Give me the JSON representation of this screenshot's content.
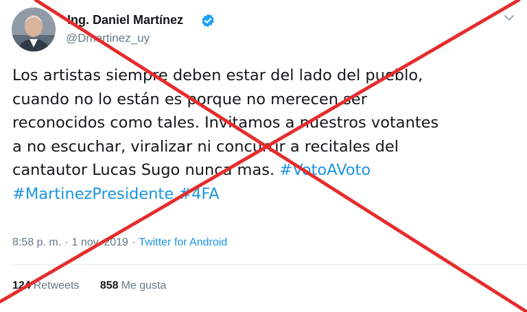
{
  "author": {
    "display_name": "Ing. Daniel Martínez",
    "handle": "@Dmartinez_uy",
    "verified": true,
    "avatar_icon": "profile-photo"
  },
  "tweet": {
    "lines": [
      {
        "text": "Los artistas siempre deben estar del lado del pueblo,",
        "tags": []
      },
      {
        "text": "cuando no lo están es porque no merecen ser",
        "tags": []
      },
      {
        "text": "reconocidos como tales. Invitamos a nuestros votantes",
        "tags": []
      },
      {
        "text": "a no escuchar, viralizar ni concurrir a recitales del",
        "tags": []
      },
      {
        "text": "cantautor Lucas Sugo nunca mas. ",
        "tags": [
          "#VotoAVoto"
        ]
      },
      {
        "text": "",
        "tags": [
          "#MartinezPresidente",
          "#4FA"
        ]
      }
    ],
    "time": "8:58 p. m.",
    "separator": "·",
    "date": "1 nov. 2019",
    "source": "Twitter for Android"
  },
  "stats": {
    "retweets_count": "124",
    "retweets_label": "Retweets",
    "likes_count": "858",
    "likes_label": "Me gusta"
  },
  "colors": {
    "text": "#14171a",
    "secondary": "#657786",
    "hashtag": "#1b95e0",
    "verified": "#1da1f2",
    "cross": "#e52d2d"
  },
  "overlay": {
    "type": "red-x-cross"
  }
}
